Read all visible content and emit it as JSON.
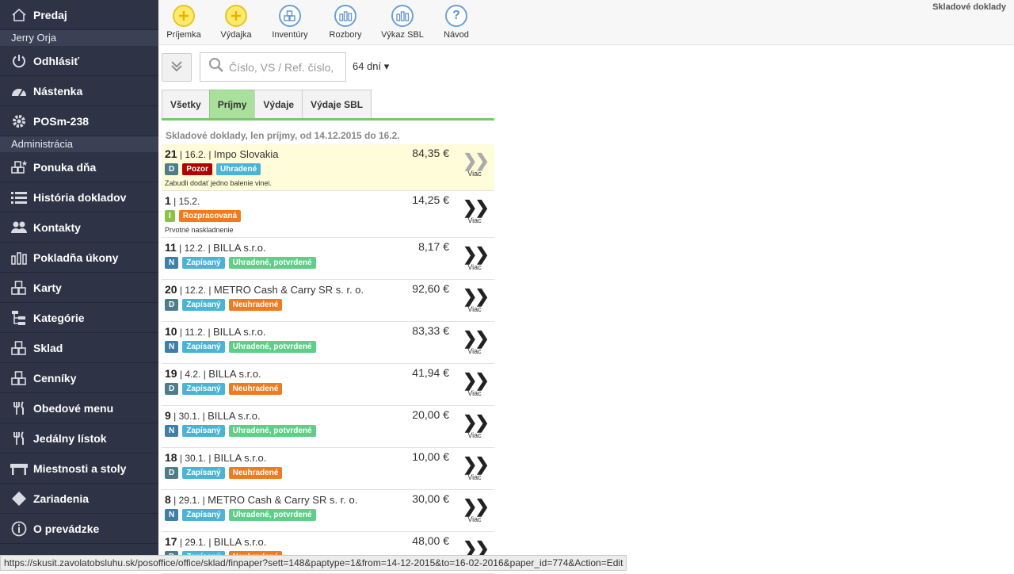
{
  "sidebar": {
    "top": {
      "label": "Predaj",
      "icon": "home-icon"
    },
    "user": "Jerry Orja",
    "items1": [
      {
        "label": "Odhlásiť",
        "icon": "power-icon"
      },
      {
        "label": "Nástenka",
        "icon": "dashboard-icon"
      },
      {
        "label": "POSm-238",
        "icon": "gear-icon"
      }
    ],
    "section": "Administrácia",
    "items2": [
      {
        "label": "Ponuka dňa",
        "icon": "boxes-star-icon"
      },
      {
        "label": "História dokladov",
        "icon": "list-icon"
      },
      {
        "label": "Kontakty",
        "icon": "users-icon"
      },
      {
        "label": "Pokladňa úkony",
        "icon": "bar-chart-icon"
      },
      {
        "label": "Karty",
        "icon": "boxes-icon"
      },
      {
        "label": "Kategórie",
        "icon": "tree-icon"
      },
      {
        "label": "Sklad",
        "icon": "boxes-icon"
      },
      {
        "label": "Cenníky",
        "icon": "boxes-icon"
      },
      {
        "label": "Obedové menu",
        "icon": "cutlery-icon"
      },
      {
        "label": "Jedálny lístok",
        "icon": "cutlery-icon"
      },
      {
        "label": "Miestnosti a stoly",
        "icon": "table-icon"
      },
      {
        "label": "Zariadenia",
        "icon": "diamond-icon"
      },
      {
        "label": "O prevádzke",
        "icon": "info-icon"
      }
    ]
  },
  "toolbar": {
    "buttons": [
      {
        "label": "Príjemka",
        "icon": "plus-icon"
      },
      {
        "label": "Výdajka",
        "icon": "plus-icon"
      },
      {
        "label": "Inventúry",
        "icon": "boxes-icon"
      },
      {
        "label": "Rozbory",
        "icon": "bar-chart-icon"
      },
      {
        "label": "Výkaz SBL",
        "icon": "bar-chart-icon"
      },
      {
        "label": "Návod",
        "icon": "question-icon"
      }
    ],
    "page_title": "Skladové doklady"
  },
  "filter": {
    "search_placeholder": "Číslo, VS / Ref. číslo,",
    "days": "64 dní ▾"
  },
  "tabs": [
    "Všetky",
    "Príjmy",
    "Výdaje",
    "Výdaje SBL"
  ],
  "list": {
    "heading": "Skladové doklady, len príjmy, od 14.12.2015 do 16.2.",
    "more_label": "Viac",
    "rows": [
      {
        "num": "21",
        "date": "16.2.",
        "name": "Impo Slovakia",
        "amount": "84,35 €",
        "type": "D",
        "badges": [
          {
            "t": "Pozor",
            "c": "red"
          },
          {
            "t": "Uhradené",
            "c": "teal"
          }
        ],
        "note": "Zabudli dodať jedno balenie vinei."
      },
      {
        "num": "1",
        "date": "15.2.",
        "name": "",
        "amount": "14,25 €",
        "type": "I",
        "badges": [
          {
            "t": "Rozpracovaná",
            "c": "orange"
          }
        ],
        "note": "Prvotné naskladnenie"
      },
      {
        "num": "11",
        "date": "12.2.",
        "name": "BILLA s.r.o.",
        "amount": "8,17 €",
        "type": "N",
        "badges": [
          {
            "t": "Zapísaný",
            "c": "teal"
          },
          {
            "t": "Uhradené, potvrdené",
            "c": "green"
          }
        ],
        "note": ""
      },
      {
        "num": "20",
        "date": "12.2.",
        "name": "METRO Cash & Carry SR s. r. o.",
        "amount": "92,60 €",
        "type": "D",
        "badges": [
          {
            "t": "Zapísaný",
            "c": "teal"
          },
          {
            "t": "Neuhradené",
            "c": "orange"
          }
        ],
        "note": ""
      },
      {
        "num": "10",
        "date": "11.2.",
        "name": "BILLA s.r.o.",
        "amount": "83,33 €",
        "type": "N",
        "badges": [
          {
            "t": "Zapísaný",
            "c": "teal"
          },
          {
            "t": "Uhradené, potvrdené",
            "c": "green"
          }
        ],
        "note": ""
      },
      {
        "num": "19",
        "date": "4.2.",
        "name": "BILLA s.r.o.",
        "amount": "41,94 €",
        "type": "D",
        "badges": [
          {
            "t": "Zapísaný",
            "c": "teal"
          },
          {
            "t": "Neuhradené",
            "c": "orange"
          }
        ],
        "note": ""
      },
      {
        "num": "9",
        "date": "30.1.",
        "name": "BILLA s.r.o.",
        "amount": "20,00 €",
        "type": "N",
        "badges": [
          {
            "t": "Zapísaný",
            "c": "teal"
          },
          {
            "t": "Uhradené, potvrdené",
            "c": "green"
          }
        ],
        "note": ""
      },
      {
        "num": "18",
        "date": "30.1.",
        "name": "BILLA s.r.o.",
        "amount": "10,00 €",
        "type": "D",
        "badges": [
          {
            "t": "Zapísaný",
            "c": "teal"
          },
          {
            "t": "Neuhradené",
            "c": "orange"
          }
        ],
        "note": ""
      },
      {
        "num": "8",
        "date": "29.1.",
        "name": "METRO Cash & Carry SR s. r. o.",
        "amount": "30,00 €",
        "type": "N",
        "badges": [
          {
            "t": "Zapísaný",
            "c": "teal"
          },
          {
            "t": "Uhradené, potvrdené",
            "c": "green"
          }
        ],
        "note": ""
      },
      {
        "num": "17",
        "date": "29.1.",
        "name": "BILLA s.r.o.",
        "amount": "48,00 €",
        "type": "D",
        "badges": [
          {
            "t": "Zapísaný",
            "c": "teal"
          },
          {
            "t": "Neuhradené",
            "c": "orange"
          }
        ],
        "note": ""
      }
    ]
  },
  "statusbar": "https://skusit.zavolatobsluhu.sk/posoffice/office/sklad/finpaper?sett=148&paptype=1&from=14-12-2015&to=16-02-2016&paper_id=774&Action=Edit"
}
